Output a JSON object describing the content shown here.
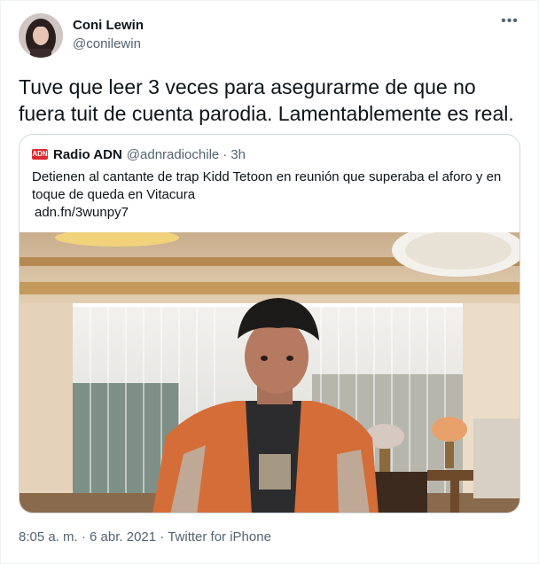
{
  "author": {
    "display_name": "Coni Lewin",
    "handle": "@conilewin"
  },
  "tweet": {
    "text": "Tuve que leer 3 veces para asegurarme de que no fuera tuit de cuenta parodia. Lamentablemente es real."
  },
  "quoted": {
    "logo_text": "ADN",
    "display_name": "Radio ADN",
    "handle": "@adnradiochile",
    "separator": "·",
    "time": "3h",
    "text": "Detienen al cantante de trap Kidd Tetoon en reunión que superaba el aforo y en toque de queda en Vitacura",
    "link": "adn.fn/3wunpy7"
  },
  "metadata": {
    "time": "8:05 a. m.",
    "separator_1": " · ",
    "date": "6 abr. 2021",
    "separator_2": " · ",
    "source": "Twitter for iPhone"
  },
  "icons": {
    "more": "more-horizontal-icon",
    "logo": "radio-adn-logo"
  },
  "colors": {
    "text_primary": "#0f1419",
    "text_secondary": "#536471",
    "border": "#cfd9de",
    "adn_red": "#e0262e"
  }
}
